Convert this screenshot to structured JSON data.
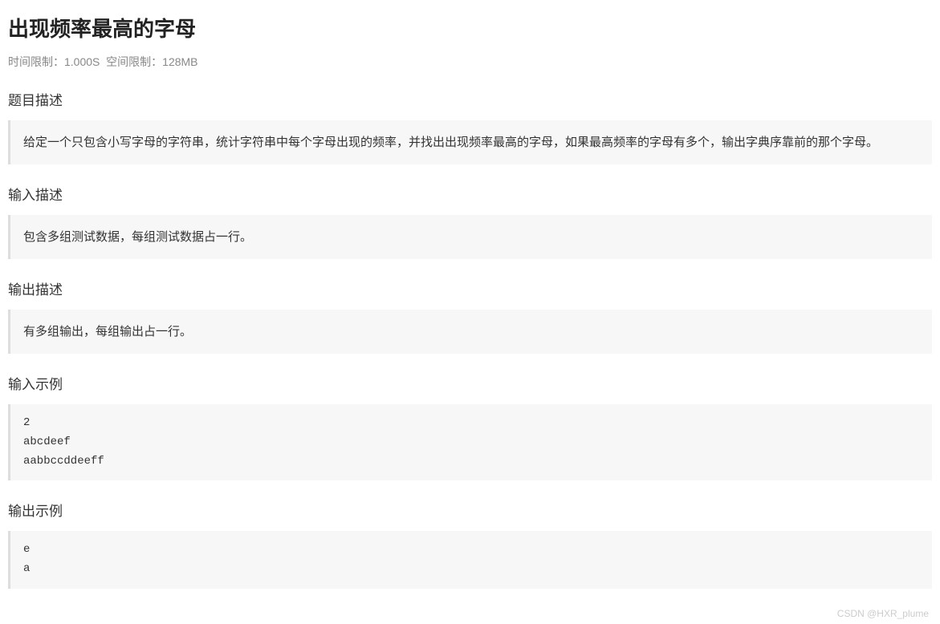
{
  "title": "出现频率最高的字母",
  "limits": {
    "timeLabel": "时间限制：",
    "timeValue": "1.000S",
    "spaceLabel": "空间限制：",
    "spaceValue": "128MB"
  },
  "sections": {
    "problemDesc": {
      "heading": "题目描述",
      "content": "给定一个只包含小写字母的字符串，统计字符串中每个字母出现的频率，并找出出现频率最高的字母，如果最高频率的字母有多个，输出字典序靠前的那个字母。"
    },
    "inputDesc": {
      "heading": "输入描述",
      "content": "包含多组测试数据，每组测试数据占一行。"
    },
    "outputDesc": {
      "heading": "输出描述",
      "content": "有多组输出，每组输出占一行。"
    },
    "inputSample": {
      "heading": "输入示例",
      "content": "2\nabcdeef\naabbccddeeff"
    },
    "outputSample": {
      "heading": "输出示例",
      "content": "e\na"
    }
  },
  "watermark": "CSDN @HXR_plume"
}
